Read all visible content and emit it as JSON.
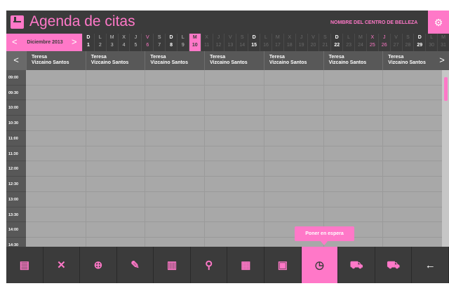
{
  "header": {
    "title": "Agenda de citas",
    "center_name": "NOMBRE DEL CENTRO DE BELLEZA",
    "logo_icon": "agenda-book-icon",
    "settings_icon": "gear-icon"
  },
  "date_nav": {
    "month_label": "Diciembre 2013",
    "prev_icon": "chevron-left-icon",
    "next_icon": "chevron-right-icon",
    "selected_day": "10",
    "days": [
      {
        "l": "D",
        "n": "1",
        "kind": "sun"
      },
      {
        "l": "L",
        "n": "2",
        "kind": "past"
      },
      {
        "l": "M",
        "n": "3",
        "kind": "past"
      },
      {
        "l": "X",
        "n": "4",
        "kind": "past"
      },
      {
        "l": "J",
        "n": "5",
        "kind": "past"
      },
      {
        "l": "V",
        "n": "6",
        "kind": "sat"
      },
      {
        "l": "S",
        "n": "7",
        "kind": "past"
      },
      {
        "l": "D",
        "n": "8",
        "kind": "sun"
      },
      {
        "l": "L",
        "n": "9",
        "kind": "past"
      },
      {
        "l": "M",
        "n": "10",
        "kind": "sel"
      },
      {
        "l": "X",
        "n": "11",
        "kind": "dim"
      },
      {
        "l": "J",
        "n": "12",
        "kind": "dim"
      },
      {
        "l": "V",
        "n": "13",
        "kind": "dim"
      },
      {
        "l": "S",
        "n": "14",
        "kind": "dim"
      },
      {
        "l": "D",
        "n": "15",
        "kind": "sun"
      },
      {
        "l": "L",
        "n": "16",
        "kind": "dim"
      },
      {
        "l": "M",
        "n": "17",
        "kind": "dim"
      },
      {
        "l": "X",
        "n": "18",
        "kind": "dim"
      },
      {
        "l": "J",
        "n": "19",
        "kind": "dim"
      },
      {
        "l": "V",
        "n": "20",
        "kind": "dim"
      },
      {
        "l": "S",
        "n": "21",
        "kind": "dim"
      },
      {
        "l": "D",
        "n": "22",
        "kind": "sun"
      },
      {
        "l": "L",
        "n": "23",
        "kind": "dim"
      },
      {
        "l": "M",
        "n": "24",
        "kind": "dim"
      },
      {
        "l": "X",
        "n": "25",
        "kind": "sat"
      },
      {
        "l": "J",
        "n": "26",
        "kind": "sat"
      },
      {
        "l": "V",
        "n": "27",
        "kind": "dim"
      },
      {
        "l": "S",
        "n": "28",
        "kind": "dim"
      },
      {
        "l": "D",
        "n": "29",
        "kind": "sun"
      },
      {
        "l": "L",
        "n": "30",
        "kind": "dim"
      },
      {
        "l": "M",
        "n": "31",
        "kind": "dim"
      }
    ]
  },
  "staff": {
    "prev_icon": "chevron-left-icon",
    "next_icon": "chevron-right-icon",
    "members": [
      {
        "first": "Teresa",
        "last": "Vizcaino Santos"
      },
      {
        "first": "Teresa",
        "last": "Vizcaino Santos"
      },
      {
        "first": "Teresa",
        "last": "Vizcaino Santos"
      },
      {
        "first": "Teresa",
        "last": "Vizcaino Santos"
      },
      {
        "first": "Teresa",
        "last": "Vizcaino Santos"
      },
      {
        "first": "Teresa",
        "last": "Vizcaino Santos"
      },
      {
        "first": "Teresa",
        "last": "Vizcaino Santos"
      }
    ]
  },
  "times": [
    "09:00",
    "09:30",
    "10:00",
    "10:30",
    "11:00",
    "11:30",
    "12:00",
    "12:30",
    "13:00",
    "13:30",
    "14:00",
    "14:30"
  ],
  "tooltip": "Poner en espera",
  "toolbar": [
    {
      "name": "document-icon",
      "glyph": "▤",
      "white": false,
      "active": false
    },
    {
      "name": "delete-x-icon",
      "glyph": "✕",
      "white": false,
      "active": false
    },
    {
      "name": "add-document-icon",
      "glyph": "⊕",
      "white": false,
      "active": false
    },
    {
      "name": "edit-note-icon",
      "glyph": "✎",
      "white": false,
      "active": false
    },
    {
      "name": "trash-icon",
      "glyph": "▥",
      "white": false,
      "active": false
    },
    {
      "name": "search-icon",
      "glyph": "⚲",
      "white": false,
      "active": false
    },
    {
      "name": "phone-icon",
      "glyph": "▦",
      "white": false,
      "active": false
    },
    {
      "name": "client-card-icon",
      "glyph": "▣",
      "white": false,
      "active": false
    },
    {
      "name": "clock-pause-icon",
      "glyph": "◷",
      "white": false,
      "active": true
    },
    {
      "name": "cart-check-icon",
      "glyph": "⛟",
      "white": false,
      "active": false
    },
    {
      "name": "cart-icon",
      "glyph": "⛟",
      "white": false,
      "active": false
    },
    {
      "name": "back-arrow-icon",
      "glyph": "←",
      "white": true,
      "active": false
    }
  ],
  "colors": {
    "accent": "#ff78c8",
    "dark": "#3b3b3b",
    "grid": "#a8a8a8"
  }
}
